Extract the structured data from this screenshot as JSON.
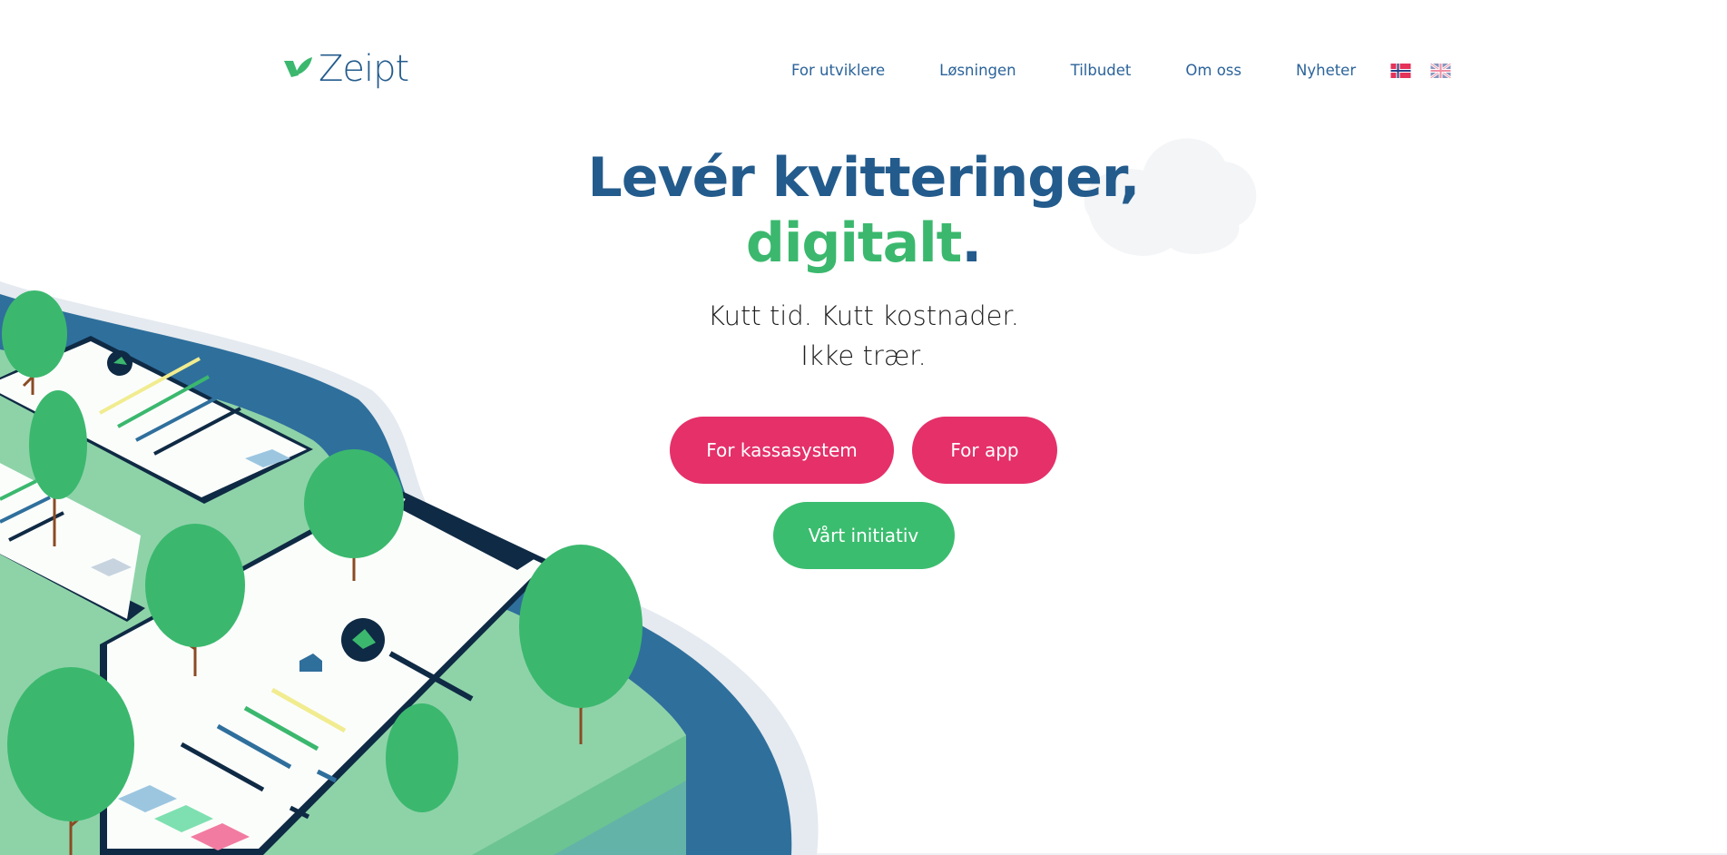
{
  "brand": {
    "name": "Zeipt",
    "logo_icon": "zeipt-leaf-icon"
  },
  "nav": {
    "items": [
      {
        "label": "For utviklere"
      },
      {
        "label": "Løsningen"
      },
      {
        "label": "Tilbudet"
      },
      {
        "label": "Om oss"
      },
      {
        "label": "Nyheter"
      }
    ],
    "languages": [
      {
        "code": "no",
        "icon": "norway-flag-icon"
      },
      {
        "code": "en",
        "icon": "uk-flag-icon"
      }
    ]
  },
  "hero": {
    "title_line1": "Levér kvitteringer,",
    "title_line2_accent": "digitalt",
    "title_line2_dot": ".",
    "subtitle_line1": "Kutt tid. Kutt kostnader.",
    "subtitle_line2": "Ikke trær.",
    "buttons": {
      "kassasystem": "For kassasystem",
      "app": "For app",
      "initiative": "Vårt initiativ"
    }
  },
  "colors": {
    "primary_blue": "#235b8c",
    "accent_green": "#3bb86e",
    "button_pink": "#e5306a",
    "button_green": "#3bbd6f"
  }
}
